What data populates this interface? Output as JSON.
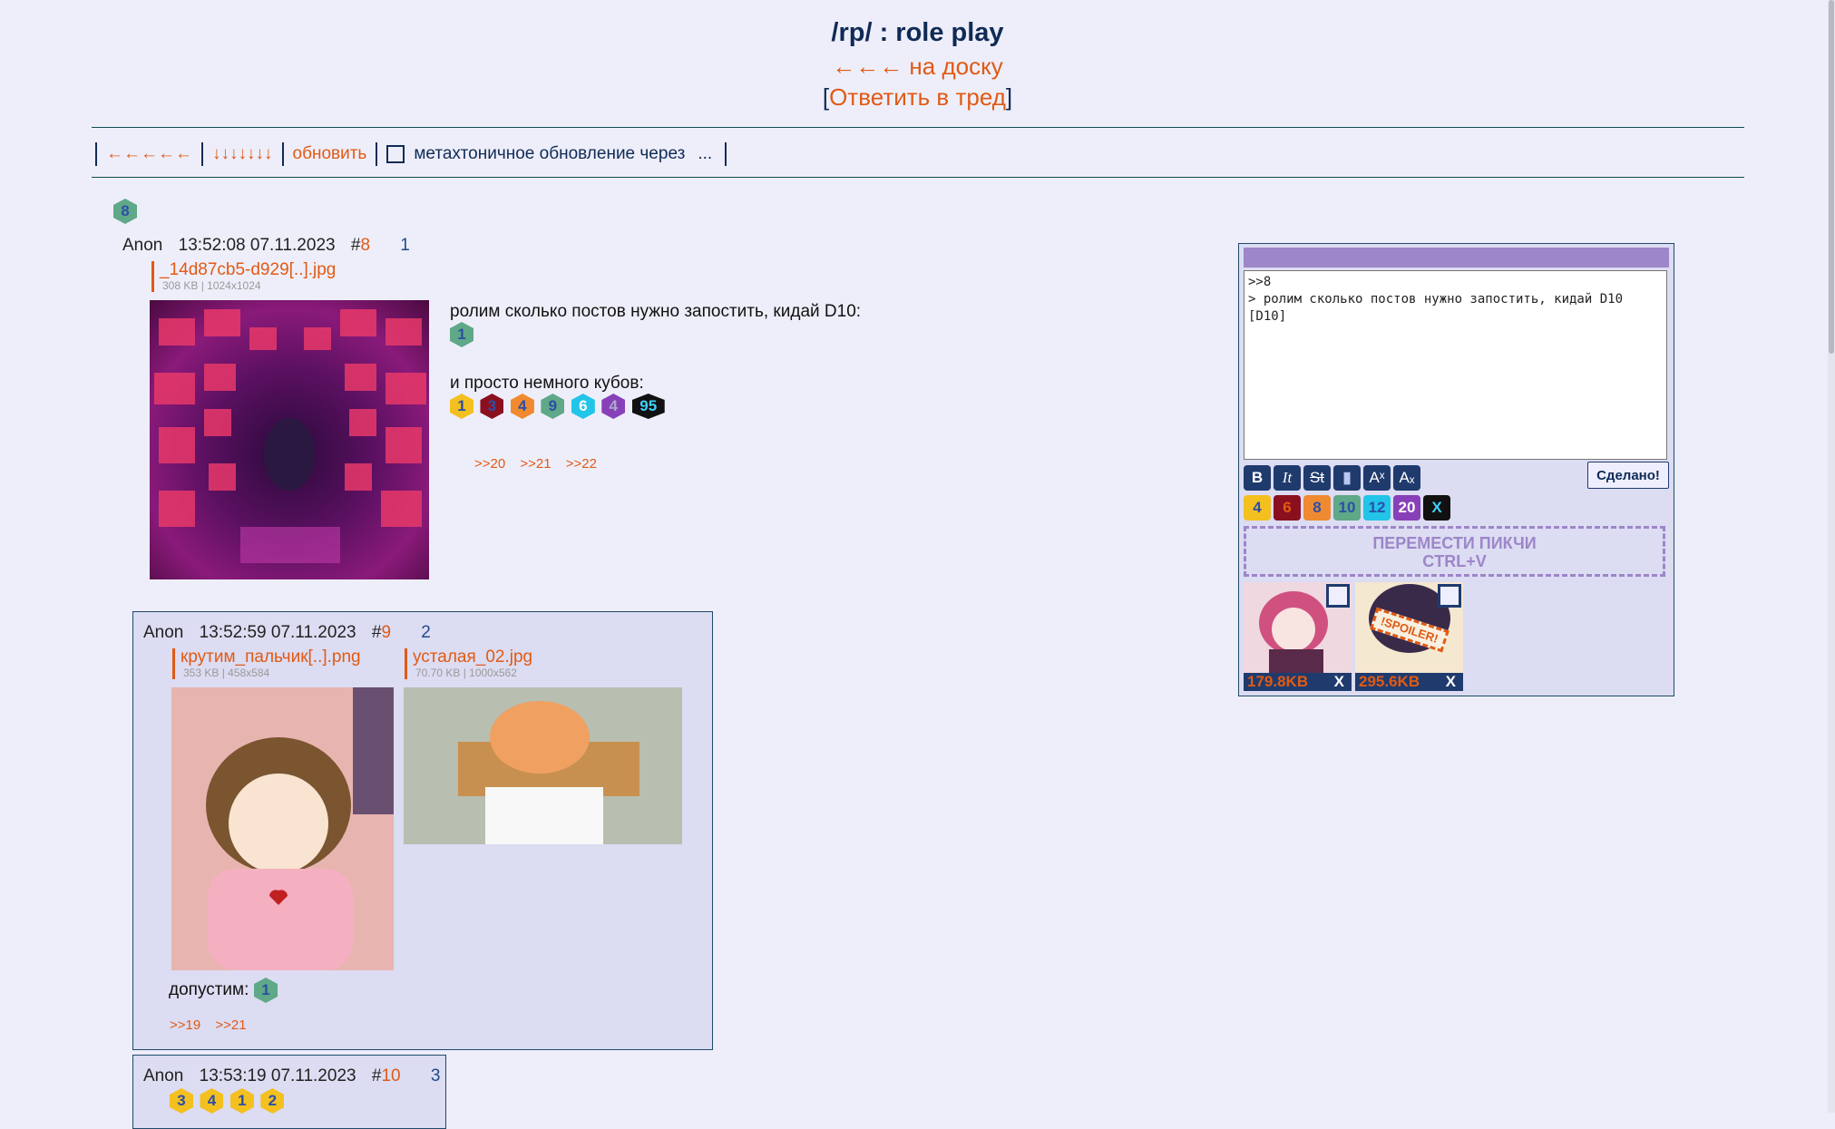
{
  "header": {
    "title": "/rp/ : role play",
    "back_link": "←←← на доску",
    "reply_bracket_open": "[",
    "reply_link": "Ответить в тред",
    "reply_bracket_close": "]"
  },
  "nav": {
    "arrows_left": "←←←←←",
    "arrows_down": "↓↓↓↓↓↓↓",
    "refresh": "обновить",
    "auto_update_label": "метахтоничное обновление через",
    "auto_update_value": "..."
  },
  "op_badge": "8",
  "posts": [
    {
      "author": "Anon",
      "datetime": "13:52:08 07.11.2023",
      "hash": "#",
      "num": "8",
      "index": "1",
      "files": [
        {
          "name": "_14d87cb5-d929[..].jpg",
          "info": "308 KB | 1024x1024"
        }
      ],
      "text1": "ролим сколько постов нужно запостить, кидай D10:",
      "dice1": [
        "1"
      ],
      "text2": "и просто немного кубов:",
      "dice2": [
        "1",
        "3",
        "4",
        "9",
        "6",
        "4",
        "95"
      ],
      "refs": [
        ">>20",
        ">>21",
        ">>22"
      ]
    },
    {
      "author": "Anon",
      "datetime": "13:52:59 07.11.2023",
      "hash": "#",
      "num": "9",
      "index": "2",
      "files": [
        {
          "name": "крутим_пальчик[..].png",
          "info": "353 KB | 458x584"
        },
        {
          "name": "усталая_02.jpg",
          "info": "70.70 KB | 1000x562"
        }
      ],
      "text1": "допустим:",
      "dice1": [
        "1"
      ],
      "refs": [
        ">>19",
        ">>21"
      ]
    },
    {
      "author": "Anon",
      "datetime": "13:53:19 07.11.2023",
      "hash": "#",
      "num": "10",
      "index": "3",
      "dice1": [
        "3",
        "4",
        "1",
        "2"
      ]
    }
  ],
  "reply_form": {
    "text_line1": ">>8",
    "text_line2": "> ролим сколько постов нужно запостить, кидай D10",
    "text_line3": "[D10]",
    "format_buttons": [
      "B",
      "It",
      "St",
      "▮",
      "Aˣ",
      "Aₓ"
    ],
    "submit": "Сделано!",
    "dice_buttons": [
      "4",
      "6",
      "8",
      "10",
      "12",
      "20",
      "X"
    ],
    "drop_line1": "ПЕРЕМЕСТИ ПИКЧИ",
    "drop_line2": "CTRL+V",
    "attachments": [
      {
        "size": "179.8KB",
        "remove": "X",
        "spoiler": ""
      },
      {
        "size": "295.6KB",
        "remove": "X",
        "spoiler": "!SPOILER!"
      }
    ]
  },
  "colors": {
    "accent": "#e05a14",
    "navy": "#1f3b6e",
    "post_bg": "#dcdcf2",
    "page_bg": "#eeeefa",
    "form_header": "#9d86c9"
  }
}
